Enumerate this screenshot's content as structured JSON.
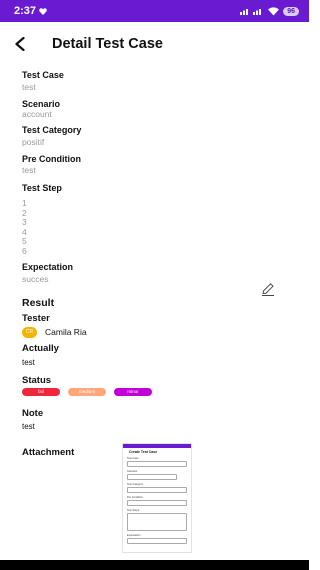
{
  "status_bar": {
    "time": "2:37",
    "battery": "96"
  },
  "app_bar": {
    "title": "Detail Test Case"
  },
  "fields": {
    "test_case": {
      "label": "Test Case",
      "value": "test"
    },
    "scenario": {
      "label": "Scenario",
      "value": "account"
    },
    "test_category": {
      "label": "Test Category",
      "value": "positif"
    },
    "pre_condition": {
      "label": "Pre Condition",
      "value": "test"
    },
    "test_step": {
      "label": "Test Step",
      "steps": [
        "1",
        "2",
        "3",
        "4",
        "5",
        "6"
      ]
    },
    "expectation": {
      "label": "Expectation",
      "value": "succes"
    }
  },
  "result": {
    "title": "Result",
    "tester_label": "Tester",
    "tester_avatar": "CR",
    "tester_name": "Camila Ria",
    "actually_label": "Actually",
    "actually_value": "test",
    "status_label": "Status",
    "status_chips": [
      "fail",
      "medium",
      "minor"
    ],
    "note_label": "Note",
    "note_value": "test",
    "attachment_label": "Attachment"
  },
  "attachment_preview": {
    "title": "Create Test Case",
    "labels": [
      "Test Case",
      "Scenario",
      "Test Category",
      "Pre Condition",
      "Test Steps",
      "Expectation"
    ]
  },
  "colors": {
    "status_bar": "#6a1bd1",
    "chip_fail": "#f0263c",
    "chip_medium": "#ffa77a",
    "chip_minor": "#c000d6",
    "avatar": "#f6b300"
  }
}
